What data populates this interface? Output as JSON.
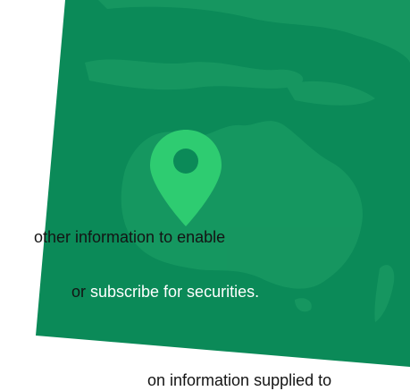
{
  "map_graphic": {
    "icon": "location-pin-icon",
    "colors": {
      "panel_green": "#0b8a58",
      "land_tint": "#189962",
      "pin_green": "#2ecc71",
      "pin_hole": "#0b8a58"
    }
  },
  "text_lines": [
    {
      "dark": "other information to enable",
      "light": ""
    },
    {
      "dark": "or ",
      "light": "subscribe for securities."
    },
    {
      "dark": "on information supplied to",
      "light": ""
    }
  ]
}
